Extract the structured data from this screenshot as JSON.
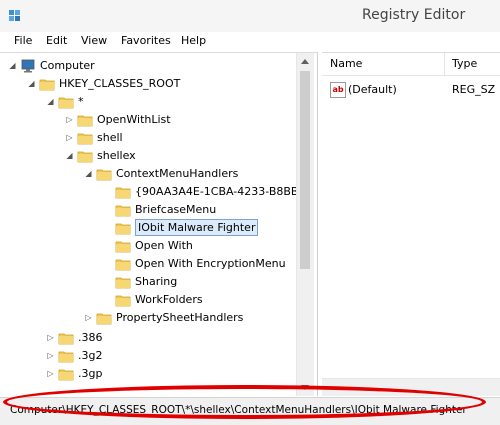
{
  "window": {
    "title": "Registry Editor"
  },
  "menu": [
    "File",
    "Edit",
    "View",
    "Favorites",
    "Help"
  ],
  "tree": [
    {
      "label": "Computer",
      "icon": "computer-icon",
      "expander": "expanded"
    },
    {
      "label": "HKEY_CLASSES_ROOT",
      "icon": "folder-icon",
      "expander": "expanded"
    },
    {
      "label": "*",
      "icon": "folder-icon",
      "expander": "expanded"
    },
    {
      "label": "OpenWithList",
      "icon": "folder-icon",
      "expander": "collapsed"
    },
    {
      "label": "shell",
      "icon": "folder-icon",
      "expander": "collapsed"
    },
    {
      "label": "shellex",
      "icon": "folder-icon",
      "expander": "expanded"
    },
    {
      "label": "ContextMenuHandlers",
      "icon": "folder-icon",
      "expander": "expanded"
    },
    {
      "label": "{90AA3A4E-1CBA-4233-B8BB-",
      "icon": "folder-icon",
      "expander": "none"
    },
    {
      "label": "BriefcaseMenu",
      "icon": "folder-icon",
      "expander": "none"
    },
    {
      "label": "IObit Malware Fighter",
      "icon": "folder-icon",
      "expander": "none",
      "selected": true
    },
    {
      "label": "Open With",
      "icon": "folder-icon",
      "expander": "none"
    },
    {
      "label": "Open With EncryptionMenu",
      "icon": "folder-icon",
      "expander": "none"
    },
    {
      "label": "Sharing",
      "icon": "folder-icon",
      "expander": "none"
    },
    {
      "label": "WorkFolders",
      "icon": "folder-icon",
      "expander": "none"
    },
    {
      "label": "PropertySheetHandlers",
      "icon": "folder-icon",
      "expander": "collapsed"
    },
    {
      "label": ".386",
      "icon": "folder-icon",
      "expander": "collapsed"
    },
    {
      "label": ".3g2",
      "icon": "folder-icon",
      "expander": "collapsed"
    },
    {
      "label": ".3gp",
      "icon": "folder-icon",
      "expander": "collapsed"
    }
  ],
  "list": {
    "columns": [
      "Name",
      "Type"
    ],
    "rows": [
      {
        "name": "(Default)",
        "type": "REG_SZ",
        "icon": "string-value-icon"
      }
    ]
  },
  "status": {
    "path": "Computer\\HKEY_CLASSES_ROOT\\*\\shellex\\ContextMenuHandlers\\IObit Malware Fighter"
  },
  "colors": {
    "highlight": "#e00000",
    "selection": "#dcebfc",
    "folder": "#f2c94c"
  }
}
